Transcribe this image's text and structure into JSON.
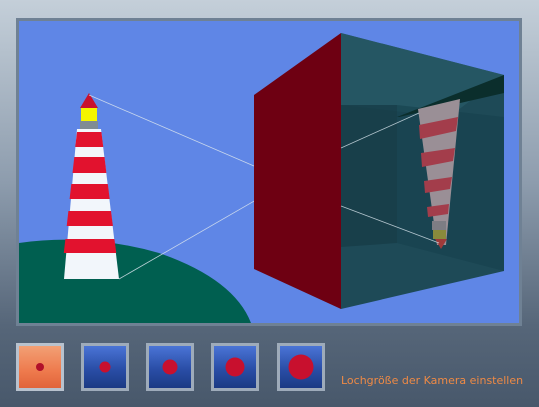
{
  "caption": "Lochgröße der Kamera einstellen",
  "selected_index": 0,
  "buttons": [
    {
      "name": "aperture-size-1-button",
      "dot": 8
    },
    {
      "name": "aperture-size-2-button",
      "dot": 11
    },
    {
      "name": "aperture-size-3-button",
      "dot": 15
    },
    {
      "name": "aperture-size-4-button",
      "dot": 19
    },
    {
      "name": "aperture-size-5-button",
      "dot": 25
    }
  ],
  "colors": {
    "sky": "#5f86e6",
    "hill": "#005f50",
    "camera_front": "#6e0012",
    "camera_body": "#1e4a57",
    "accent": "#ee8a45",
    "dot": "#c8102e"
  }
}
